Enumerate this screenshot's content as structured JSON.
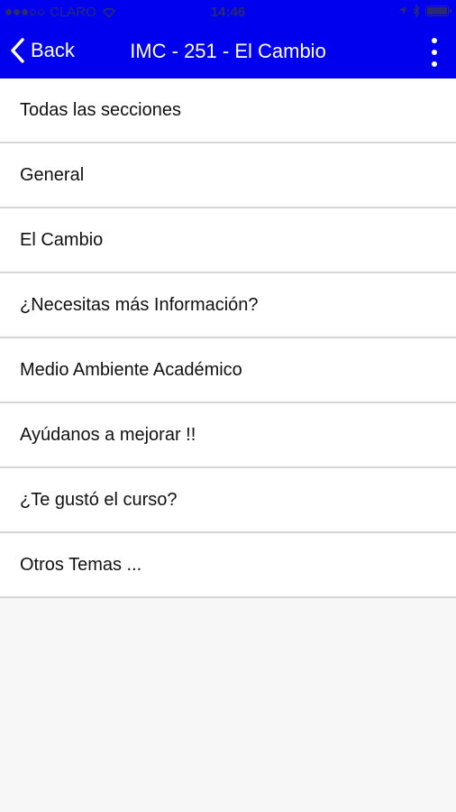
{
  "status_bar": {
    "carrier": "CLARO",
    "time": "14:46",
    "battery_level": 1.0,
    "signal_icon": "signal-dots-icon",
    "wifi_icon": "wifi-icon",
    "location_icon": "location-arrow-icon",
    "bluetooth_icon": "bluetooth-icon",
    "battery_icon": "battery-icon"
  },
  "nav": {
    "back_label": "Back",
    "back_icon": "chevron-left-icon",
    "title": "IMC - 251 - El Cambio",
    "more_icon": "more-vertical-icon"
  },
  "colors": {
    "header_bg": "#0000ee",
    "header_text": "#ffffff",
    "list_bg": "#ffffff",
    "separator": "#d6d6d6",
    "page_bg": "#f7f7f7"
  },
  "sections": [
    {
      "label": "Todas las secciones"
    },
    {
      "label": "General"
    },
    {
      "label": "El Cambio"
    },
    {
      "label": "¿Necesitas más Información?"
    },
    {
      "label": "Medio Ambiente Académico"
    },
    {
      "label": "Ayúdanos a mejorar !!"
    },
    {
      "label": "¿Te gustó el curso?"
    },
    {
      "label": "Otros Temas ..."
    }
  ]
}
